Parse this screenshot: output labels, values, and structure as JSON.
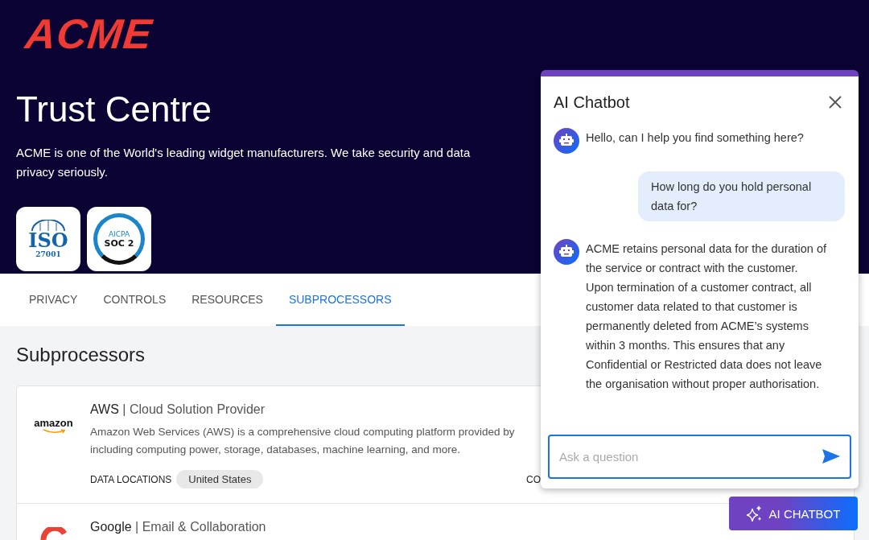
{
  "header": {
    "logo": "ACME",
    "title": "Trust Centre",
    "description": "ACME is one of the World's leading widget manufacturers. We take security and data privacy seriously.",
    "badges": [
      {
        "kind": "iso",
        "main": "ISO",
        "sub": "27001"
      },
      {
        "kind": "soc",
        "main": "SOC 2",
        "sub": "AICPA"
      }
    ]
  },
  "tabs": [
    {
      "label": "PRIVACY",
      "selected": false
    },
    {
      "label": "CONTROLS",
      "selected": false
    },
    {
      "label": "RESOURCES",
      "selected": false
    },
    {
      "label": "SUBPROCESSORS",
      "selected": true
    }
  ],
  "section_title": "Subprocessors",
  "subprocessors": [
    {
      "kind": "amazon",
      "logo_text": "amazon",
      "name": "AWS",
      "separator": "|",
      "category": "Cloud Solution Provider",
      "description": "Amazon Web Services (AWS) is a comprehensive cloud computing platform provided by including computing power, storage, databases, machine learning, and more.",
      "locations_label": "DATA LOCATIONS",
      "locations": [
        "United States"
      ],
      "compliance_label": "CO"
    },
    {
      "kind": "google",
      "name": "Google",
      "separator": "|",
      "category": "Email & Collaboration"
    }
  ],
  "chatbot": {
    "title": "AI Chatbot",
    "messages": [
      {
        "kind": "bot",
        "text": "Hello, can I help you find something here?"
      },
      {
        "kind": "user",
        "text": "How long do you hold personal data for?"
      },
      {
        "kind": "bot",
        "text": "ACME retains personal data for the duration of the service or contract with the customer. Upon termination of a customer contract, all customer data related to that customer is permanently deleted from ACME’s systems within 3 months. This ensures that any Confidential or Restricted data does not leave the organisation without proper authorisation."
      }
    ],
    "input": {
      "placeholder": "Ask a question"
    }
  },
  "chat_button": {
    "label": "AI CHATBOT"
  }
}
